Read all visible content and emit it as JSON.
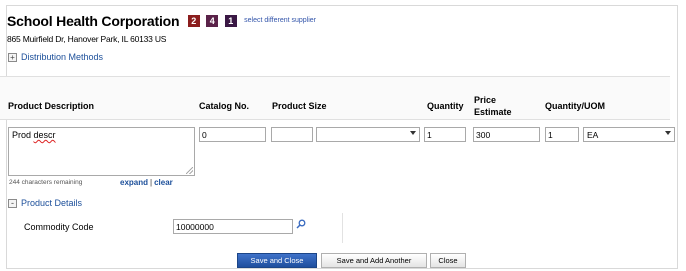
{
  "supplier": {
    "name": "School Health Corporation",
    "badges": [
      "2",
      "4",
      "1"
    ],
    "change_link": "select different supplier",
    "address": "865 Muirfield Dr, Hanover Park, IL 60133 US"
  },
  "distribution": {
    "label": "Distribution Methods",
    "toggle": "+"
  },
  "columns": {
    "description": "Product Description",
    "catalog": "Catalog No.",
    "size": "Product Size",
    "quantity": "Quantity",
    "price_line1": "Price",
    "price_line2": "Estimate",
    "uom": "Quantity/UOM"
  },
  "row": {
    "description_prefix": "Prod ",
    "description_misspelled": "descr",
    "catalog_no": "0",
    "size": "",
    "size_unit": "",
    "quantity": "1",
    "price": "300",
    "uom_qty": "1",
    "uom": "EA"
  },
  "remaining_text": "244 characters remaining",
  "links": {
    "expand": "expand",
    "separator": "|",
    "clear": "clear"
  },
  "product_details": {
    "label": "Product Details",
    "toggle": "-"
  },
  "commodity": {
    "label": "Commodity Code",
    "value": "10000000"
  },
  "buttons": {
    "save_close": "Save and Close",
    "save_add": "Save and Add Another",
    "close": "Close"
  },
  "colors": {
    "link": "#1c4f9a",
    "primary_button": "#2a5cb0",
    "badge_red": "#8b1d1d",
    "badge_purple": "#5a2249",
    "badge_dark": "#3a1844"
  }
}
